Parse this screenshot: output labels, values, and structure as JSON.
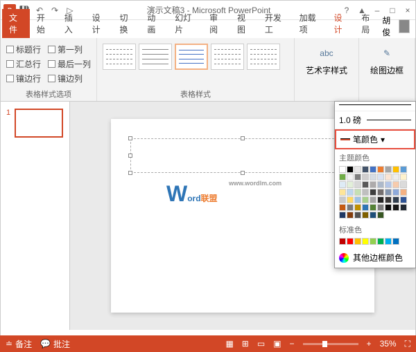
{
  "title": "演示文稿3 - Microsoft PowerPoint",
  "qat": {
    "save": "💾",
    "undo": "↶",
    "redo": "↷",
    "start": "▷"
  },
  "tabs": {
    "file": "文件",
    "start": "开始",
    "insert": "插入",
    "design_top": "设计",
    "transition": "切换",
    "anim": "动画",
    "slideshow": "幻灯片",
    "review": "审阅",
    "view": "视图",
    "dev": "开发工",
    "addin": "加载项",
    "design": "设计",
    "layout": "布局"
  },
  "user": "胡俊",
  "table_opts": {
    "header": "标题行",
    "first_col": "第一列",
    "total": "汇总行",
    "last_col": "最后一列",
    "banded_r": "镶边行",
    "banded_c": "镶边列"
  },
  "groups": {
    "table_style_opts": "表格样式选项",
    "table_styles": "表格样式"
  },
  "buttons": {
    "wordart": "艺术字样式",
    "border": "绘图边框"
  },
  "slide_num": "1",
  "logo": {
    "w": "W",
    "ord": "ord",
    "lm": "联盟",
    "url": "www.wordlm.com"
  },
  "dd": {
    "weight": "1.0 磅",
    "pen": "笔颜色",
    "theme": "主题颜色",
    "standard": "标准色",
    "more": "其他边框颜色"
  },
  "status": {
    "notes": "备注",
    "comments": "批注",
    "zoom": "35%"
  },
  "win": {
    "help": "?",
    "min": "–",
    "max": "□",
    "close": "×",
    "collapse": "▲"
  },
  "theme_colors": [
    "#fff",
    "#000",
    "#e7e6e6",
    "#44546a",
    "#4472c4",
    "#ed7d31",
    "#a5a5a5",
    "#ffc000",
    "#5b9bd5",
    "#70ad47",
    "#f2f2f2",
    "#7f7f7f",
    "#d0cece",
    "#d6dce4",
    "#d9e2f3",
    "#fbe5d5",
    "#ededed",
    "#fff2cc",
    "#deebf6",
    "#e2efd9",
    "#d8d8d8",
    "#595959",
    "#aeabab",
    "#adb9ca",
    "#b4c6e7",
    "#f7cbac",
    "#dbdbdb",
    "#fee599",
    "#bdd7ee",
    "#c5e0b3",
    "#bfbfbf",
    "#3f3f3f",
    "#757070",
    "#8496b0",
    "#8eaadb",
    "#f4b183",
    "#c9c9c9",
    "#ffd965",
    "#9cc3e5",
    "#a8d08d",
    "#a5a5a5",
    "#262626",
    "#3a3838",
    "#323f4f",
    "#2f5496",
    "#c55a11",
    "#7b7b7b",
    "#bf9000",
    "#2e75b5",
    "#538135",
    "#7f7f7f",
    "#0c0c0c",
    "#171616",
    "#222a35",
    "#1f3864",
    "#833c0b",
    "#525252",
    "#7f6000",
    "#1e4e79",
    "#375623"
  ],
  "std_colors": [
    "#c00000",
    "#ff0000",
    "#ffc000",
    "#ffff00",
    "#92d050",
    "#00b050",
    "#00b0f0",
    "#0070c0"
  ]
}
